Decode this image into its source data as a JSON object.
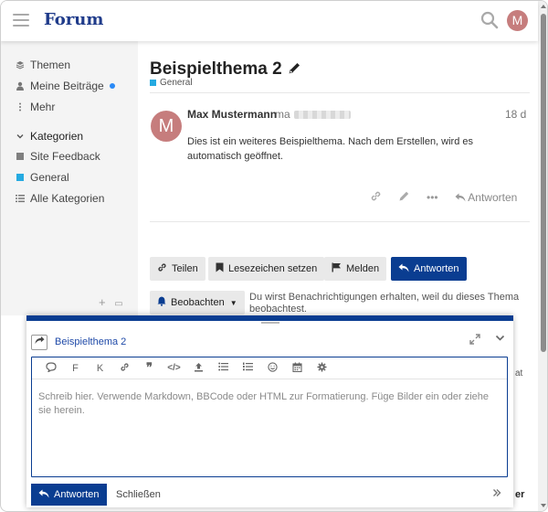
{
  "header": {
    "logo": "Forum",
    "avatar_letter": "M"
  },
  "sidebar": {
    "items": [
      {
        "icon": "layers-icon",
        "label": "Themen"
      },
      {
        "icon": "user-icon",
        "label": "Meine Beiträge"
      },
      {
        "icon": "more-vertical-icon",
        "label": "Mehr"
      }
    ],
    "categories_label": "Kategorien",
    "categories": [
      {
        "label": "Site Feedback",
        "color": "#808080"
      },
      {
        "label": "General",
        "color": "#25AAE1"
      },
      {
        "label": "Alle Kategorien",
        "icon": "list-icon"
      }
    ]
  },
  "topic": {
    "title": "Beispielthema 2",
    "category": "General",
    "category_color": "#25AAE1"
  },
  "post": {
    "avatar_letter": "M",
    "author": "Max Mustermann",
    "handle": "ma",
    "date": "18 d",
    "body": "Dies ist ein weiteres Beispielthema. Nach dem Erstellen, wird es automatisch geöffnet.",
    "reply_label": "Antworten"
  },
  "actions": {
    "share": "Teilen",
    "bookmark": "Lesezeichen setzen",
    "flag": "Melden",
    "reply": "Antworten",
    "watch": "Beobachten",
    "notify_text": "Du wirst Benachrichtigungen erhalten, weil du dieses Thema beobachtest."
  },
  "background_hints": {
    "at": "at",
    "er": "er"
  },
  "composer": {
    "title": "Beispielthema 2",
    "placeholder": "Schreib hier. Verwende Markdown, BBCode oder HTML zur Formatierung. Füge Bilder ein oder ziehe sie herein.",
    "reply_label": "Antworten",
    "close_label": "Schließen",
    "toolbar_bold": "F",
    "toolbar_italic": "K"
  },
  "colors": {
    "primary": "#0A3D91",
    "link": "#1F4AA8",
    "avatar": "#C67D7D",
    "unread_dot": "#2A8AF6"
  }
}
